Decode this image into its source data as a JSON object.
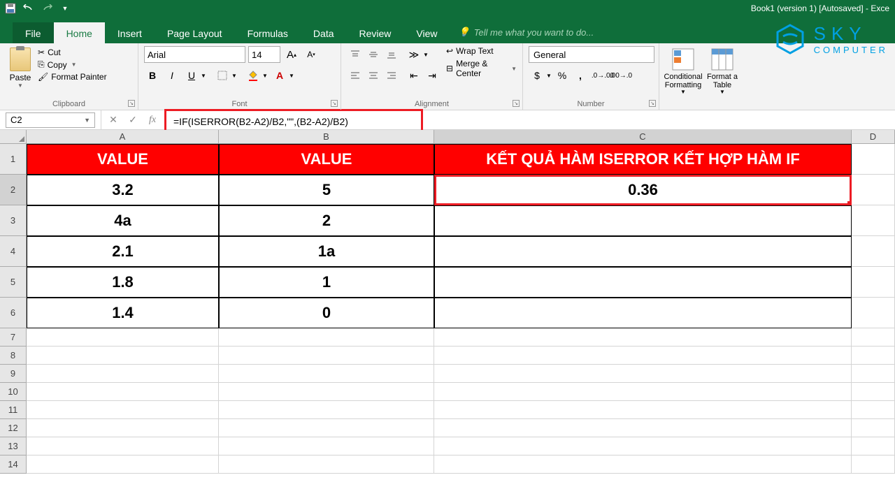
{
  "app": {
    "title": "Book1 (version 1) [Autosaved] - Exce"
  },
  "tabs": {
    "file": "File",
    "home": "Home",
    "insert": "Insert",
    "page_layout": "Page Layout",
    "formulas": "Formulas",
    "data": "Data",
    "review": "Review",
    "view": "View",
    "tell_me": "Tell me what you want to do..."
  },
  "ribbon": {
    "clipboard": {
      "label": "Clipboard",
      "paste": "Paste",
      "cut": "Cut",
      "copy": "Copy",
      "format_painter": "Format Painter"
    },
    "font": {
      "label": "Font",
      "name": "Arial",
      "size": "14"
    },
    "alignment": {
      "label": "Alignment",
      "wrap": "Wrap Text",
      "merge": "Merge & Center"
    },
    "number": {
      "label": "Number",
      "format": "General"
    },
    "styles": {
      "conditional": "Conditional Formatting",
      "table": "Format a Table"
    }
  },
  "formula_bar": {
    "cell_ref": "C2",
    "formula": "=IF(ISERROR(B2-A2)/B2,\"\",(B2-A2)/B2)"
  },
  "columns": {
    "A": "A",
    "B": "B",
    "C": "C",
    "D": "D"
  },
  "sheet": {
    "headers": {
      "A": "VALUE",
      "B": "VALUE",
      "C": "KẾT QUẢ HÀM ISERROR KẾT HỢP HÀM IF"
    },
    "rows": [
      {
        "A": "3.2",
        "B": "5",
        "C": "0.36"
      },
      {
        "A": "4a",
        "B": "2",
        "C": ""
      },
      {
        "A": "2.1",
        "B": "1a",
        "C": ""
      },
      {
        "A": "1.8",
        "B": "1",
        "C": ""
      },
      {
        "A": "1.4",
        "B": "0",
        "C": ""
      }
    ]
  },
  "logo": {
    "top": "SKY",
    "bottom": "COMPUTER"
  }
}
